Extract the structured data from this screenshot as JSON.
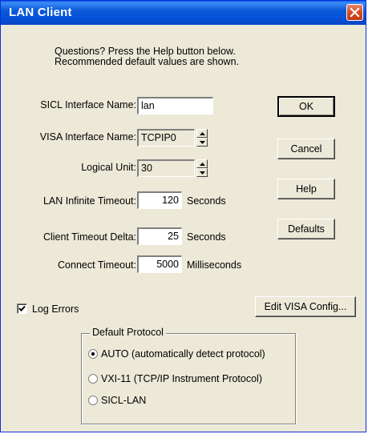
{
  "window": {
    "title": "LAN Client"
  },
  "hint": {
    "line1": "Questions?  Press the Help button below.",
    "line2": "Recommended default values are shown."
  },
  "fields": {
    "sicl_name_label": "SICL Interface Name:",
    "sicl_name_value": "lan",
    "visa_name_label": "VISA Interface Name:",
    "visa_name_value": "TCPIP0",
    "logical_unit_label": "Logical Unit:",
    "logical_unit_value": "30",
    "lan_infinite_timeout_label": "LAN Infinite Timeout:",
    "lan_infinite_timeout_value": "120",
    "lan_infinite_timeout_unit": "Seconds",
    "client_timeout_delta_label": "Client Timeout Delta:",
    "client_timeout_delta_value": "25",
    "client_timeout_delta_unit": "Seconds",
    "connect_timeout_label": "Connect Timeout:",
    "connect_timeout_value": "5000",
    "connect_timeout_unit": "Milliseconds"
  },
  "buttons": {
    "ok": "OK",
    "cancel": "Cancel",
    "help": "Help",
    "defaults": "Defaults",
    "edit_visa": "Edit VISA Config..."
  },
  "log_errors": {
    "label": "Log Errors",
    "checked": true
  },
  "protocol": {
    "legend": "Default Protocol",
    "options": [
      {
        "label": "AUTO (automatically detect protocol)",
        "selected": true
      },
      {
        "label": "VXI-11 (TCP/IP Instrument Protocol)",
        "selected": false
      },
      {
        "label": "SICL-LAN",
        "selected": false
      }
    ]
  },
  "colors": {
    "titlebar": "#0551d8",
    "face": "#ece9d8",
    "close": "#d8491e"
  }
}
